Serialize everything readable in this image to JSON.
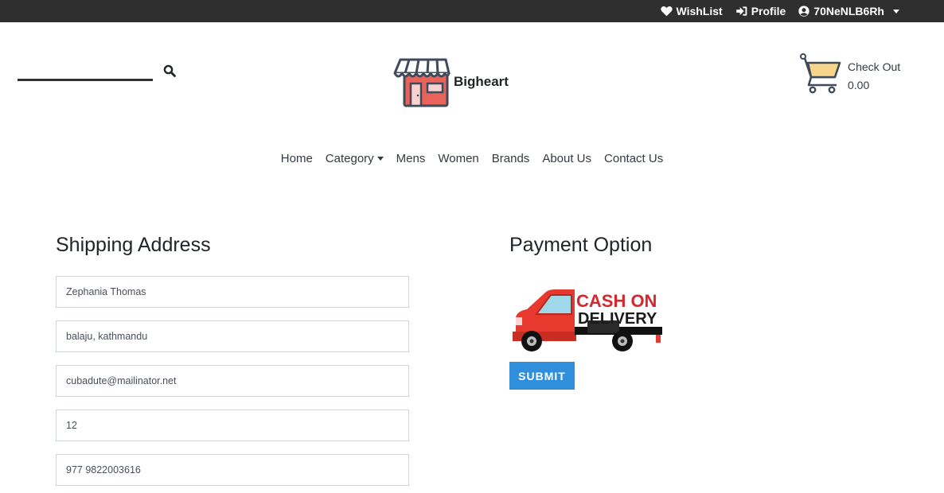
{
  "topbar": {
    "wishlist_label": "WishList",
    "profile_label": "Profile",
    "user_label": "70NeNLB6Rh"
  },
  "header": {
    "search": {
      "value": "",
      "placeholder": ""
    },
    "brand_name": "Bigheart",
    "checkout_label": "Check Out",
    "cart_total": "0.00"
  },
  "nav": {
    "items": [
      {
        "label": "Home"
      },
      {
        "label": "Category",
        "dropdown": true
      },
      {
        "label": "Mens"
      },
      {
        "label": "Women"
      },
      {
        "label": "Brands"
      },
      {
        "label": "About Us"
      },
      {
        "label": "Contact Us"
      }
    ]
  },
  "shipping": {
    "title": "Shipping Address",
    "fields": [
      {
        "value": "Zephania Thomas"
      },
      {
        "value": "balaju, kathmandu"
      },
      {
        "value": "cubadute@mailinator.net"
      },
      {
        "value": "12"
      },
      {
        "value": "977 9822003616"
      }
    ]
  },
  "payment": {
    "title": "Payment Option",
    "cod_line1": "CASH ON",
    "cod_line2": "DELIVERY",
    "submit_label": "SUBMIT"
  },
  "colors": {
    "topbar_bg": "#2f2f2f",
    "submit_bg": "#2f8fdd",
    "truck_red": "#e8392f",
    "cod_text_red": "#d7262e",
    "shop_roof": "#e9635a",
    "cart_basket": "#f7d78b"
  },
  "icons": [
    "heart-icon",
    "sign-in-icon",
    "user-circle-icon",
    "search-icon",
    "shop-logo-icon",
    "cart-icon",
    "cod-truck-icon"
  ]
}
